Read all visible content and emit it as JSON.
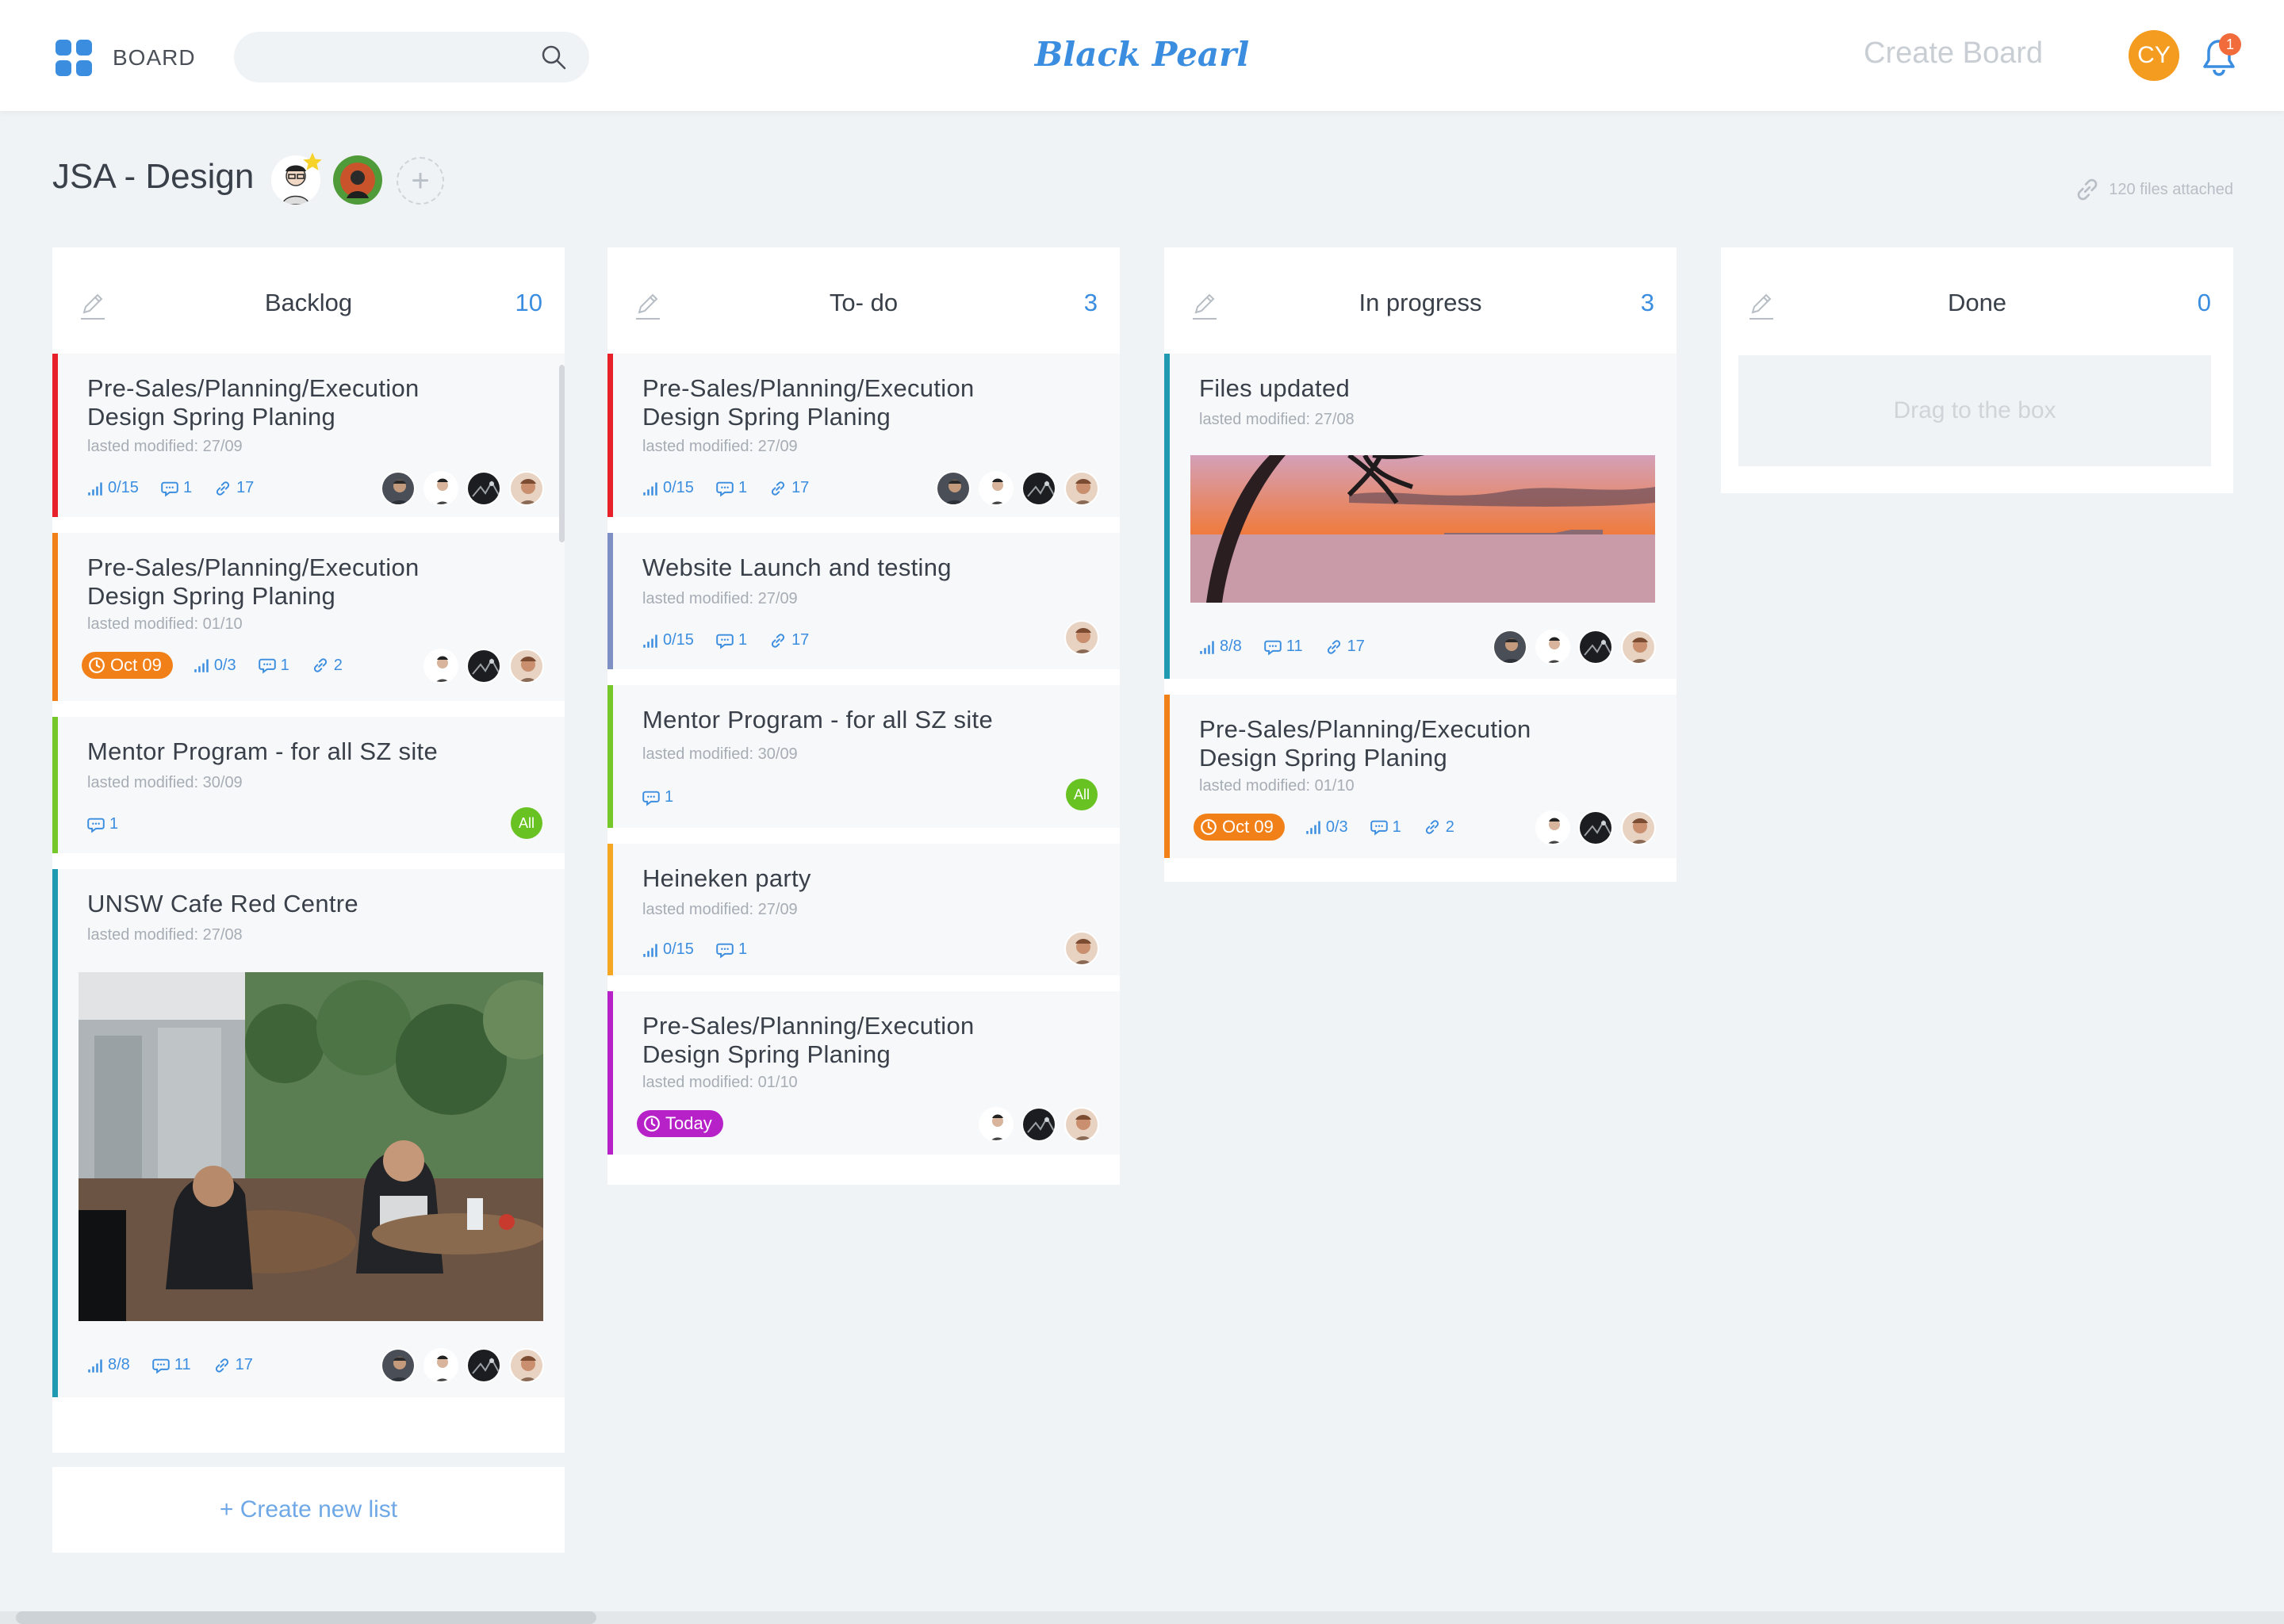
{
  "header": {
    "board_menu_label": "BOARD",
    "search_placeholder": "",
    "brand": "Black Pearl",
    "create_board": "Create Board",
    "user_initials": "CY",
    "notification_count": "1",
    "accent_color": "#3b8de0"
  },
  "board": {
    "title": "JSA - Design",
    "add_member": "+",
    "files_attached": "120 files attached"
  },
  "columns": [
    {
      "title": "Backlog",
      "count": "10",
      "cards": [
        {
          "title_line1": "Pre-Sales/Planning/Execution",
          "title_line2": "Design Spring Planing",
          "modified": "lasted modified: 27/09",
          "progress": "0/15",
          "comments": "1",
          "links": "17",
          "accent": "#e8202a"
        },
        {
          "title_line1": "Pre-Sales/Planning/Execution",
          "title_line2": "Design Spring Planing",
          "modified": "lasted modified: 01/10",
          "date": "Oct 09",
          "progress": "0/3",
          "comments": "1",
          "links": "2",
          "accent": "#f28019"
        },
        {
          "title_line1": "Mentor Program - for all SZ site",
          "modified": "lasted modified: 30/09",
          "comments": "1",
          "badge": "All",
          "accent": "#76c82a"
        },
        {
          "title_line1": "UNSW Cafe Red Centre",
          "modified": "lasted modified: 27/08",
          "progress": "8/8",
          "comments": "11",
          "links": "17",
          "accent": "#1f9ab0"
        }
      ]
    },
    {
      "title": "To- do",
      "count": "3",
      "cards": [
        {
          "title_line1": "Pre-Sales/Planning/Execution",
          "title_line2": "Design Spring Planing",
          "modified": "lasted modified: 27/09",
          "progress": "0/15",
          "comments": "1",
          "links": "17",
          "accent": "#e8202a"
        },
        {
          "title_line1": "Website Launch and testing",
          "modified": "lasted modified: 27/09",
          "progress": "0/15",
          "comments": "1",
          "links": "17",
          "accent": "#7e8fc4"
        },
        {
          "title_line1": "Mentor Program - for all SZ site",
          "modified": "lasted modified: 30/09",
          "comments": "1",
          "badge": "All",
          "accent": "#76c82a"
        },
        {
          "title_line1": "Heineken party",
          "modified": "lasted modified: 27/09",
          "progress": "0/15",
          "comments": "1",
          "accent": "#f5a623"
        },
        {
          "title_line1": "Pre-Sales/Planning/Execution",
          "title_line2": "Design Spring Planing",
          "modified": "lasted modified: 01/10",
          "date": "Today",
          "accent": "#b722c8"
        }
      ]
    },
    {
      "title": "In progress",
      "count": "3",
      "cards": [
        {
          "title_line1": "Files updated",
          "modified": "lasted modified: 27/08",
          "progress": "8/8",
          "comments": "11",
          "links": "17",
          "accent": "#1f9ab0"
        },
        {
          "title_line1": "Pre-Sales/Planning/Execution",
          "title_line2": "Design Spring Planing",
          "modified": "lasted modified: 01/10",
          "date": "Oct 09",
          "progress": "0/3",
          "comments": "1",
          "links": "2",
          "accent": "#f28019"
        }
      ]
    },
    {
      "title": "Done",
      "count": "0",
      "drag_hint": "Drag to the box"
    }
  ],
  "create_list": "+ Create new list",
  "date_colors": {
    "overdue": "#f28019",
    "today": "#b722c8"
  }
}
